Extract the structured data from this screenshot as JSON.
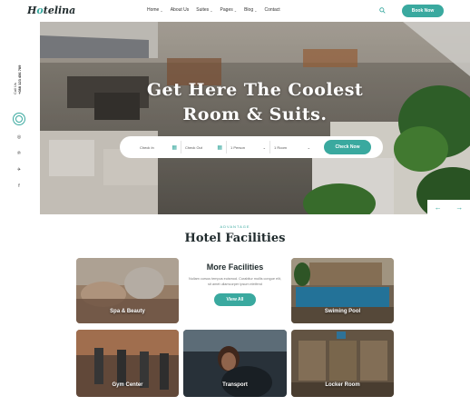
{
  "brand": {
    "logo_prefix": "H",
    "logo_o": "o",
    "logo_suffix": "telina",
    "accent": "#3aa99f"
  },
  "nav": [
    {
      "label": "Home",
      "dropdown": true
    },
    {
      "label": "About Us",
      "dropdown": false
    },
    {
      "label": "Suites",
      "dropdown": true
    },
    {
      "label": "Pages",
      "dropdown": true
    },
    {
      "label": "Blog",
      "dropdown": true
    },
    {
      "label": "Contact",
      "dropdown": false
    }
  ],
  "header": {
    "book_label": "Book Now",
    "search_icon": "search-icon"
  },
  "rail": {
    "phone_label": "Call Us",
    "phone_number": "+088 123 456 789",
    "social": [
      "instagram-icon",
      "pinterest-icon",
      "twitter-icon",
      "facebook-icon"
    ]
  },
  "hero": {
    "title_line1": "Get Here The Coolest",
    "title_line2": "Room & Suits.",
    "check_in": "Check In",
    "check_out": "Check Out",
    "persons": "1 Person",
    "rooms": "1 Room",
    "check_button": "Check Now",
    "prev_arrow": "←",
    "next_arrow": "→"
  },
  "facilities": {
    "eyebrow": "ADVANTAGE",
    "title": "Hotel Facilities",
    "more_title": "More Facilities",
    "more_desc": "Nullam cursus tempus euismod. Curabitur mollis congue elit, sit amet ullamcorper ipsum eleifend",
    "view_all": "View All",
    "cards": [
      "Spa & Beauty",
      "Swiming Pool",
      "Gym Center",
      "Transport",
      "Locker Room"
    ]
  }
}
